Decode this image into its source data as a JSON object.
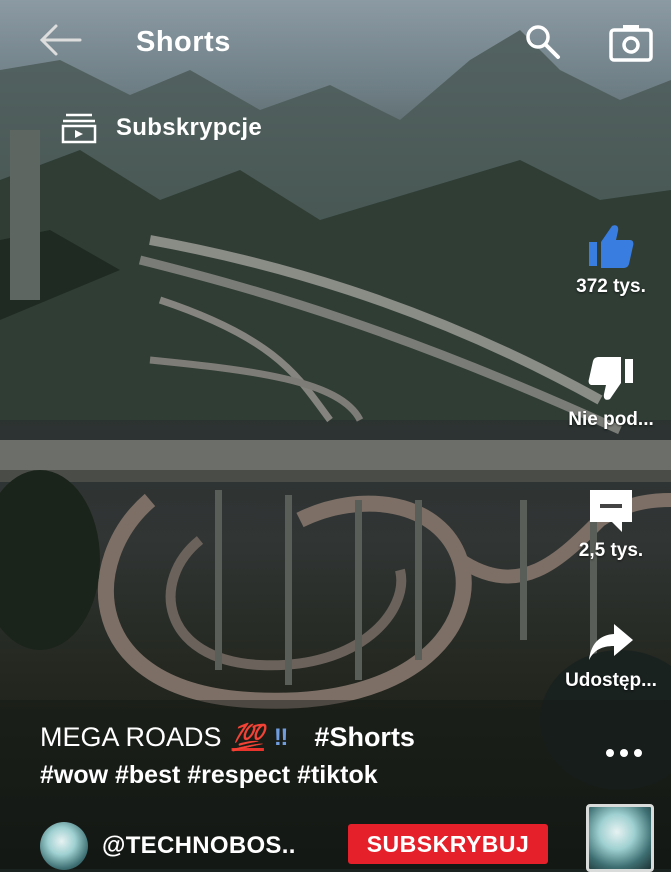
{
  "header": {
    "title": "Shorts",
    "subscriptions_label": "Subskrypcje"
  },
  "actions": {
    "like_count": "372 tys.",
    "dislike_label": "Nie pod...",
    "comments_count": "2,5 tys.",
    "share_label": "Udostęp..."
  },
  "video": {
    "title_text": "MEGA ROADS",
    "emoji_100": "💯",
    "emoji_excl": "‼",
    "title_tag": "#Shorts",
    "hashtags": "#wow #best #respect #tiktok"
  },
  "channel": {
    "handle": "@TECHNOBOS..",
    "subscribe_label": "SUBSKRYBUJ"
  },
  "icons": {
    "back": "back-arrow-icon",
    "search": "search-icon",
    "camera": "camera-icon",
    "subscriptions": "subscriptions-icon",
    "like": "thumbs-up-icon",
    "dislike": "thumbs-down-icon",
    "comment": "comment-icon",
    "share": "share-icon",
    "more": "more-dots-icon"
  },
  "colors": {
    "like_active": "#3a7de0",
    "subscribe_bg": "#e5202b"
  }
}
